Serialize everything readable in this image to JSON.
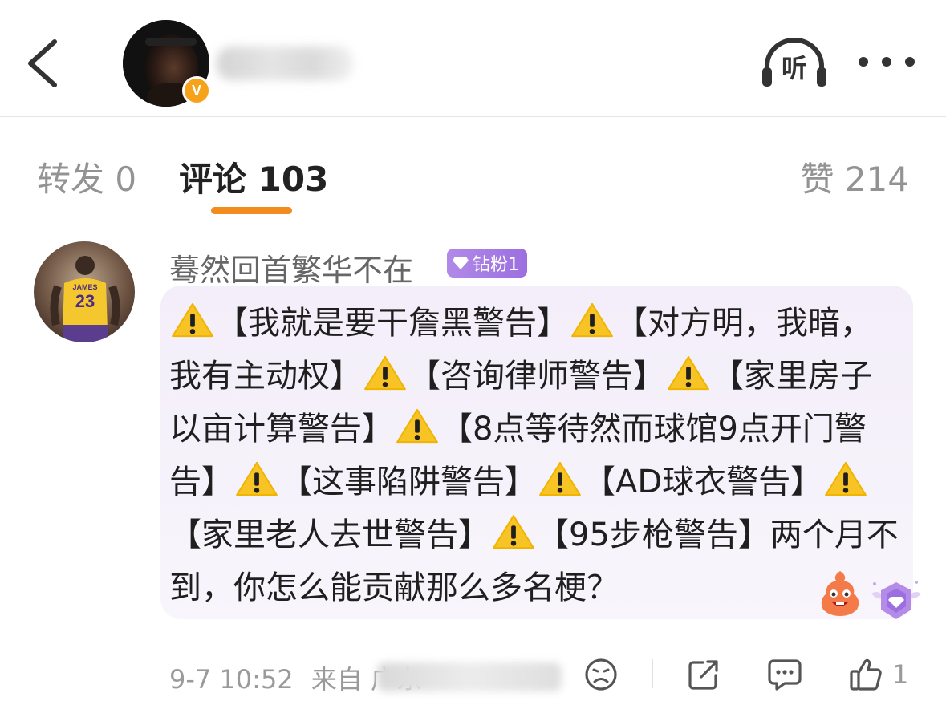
{
  "header": {
    "back_icon": "chevron-left-icon",
    "verified_badge": "V",
    "listen_label": "听",
    "more_icon": "more-dots-icon"
  },
  "tabs": {
    "repost": "转发 0",
    "comments": "评论 103",
    "likes": "赞 214",
    "active_color": "#f28c1e"
  },
  "comment": {
    "username": "蓦然回首繁华不在",
    "fan_badge": "钻粉1",
    "segments": [
      {
        "warn": true,
        "text": "【我就是要干詹黑警告】"
      },
      {
        "warn": true,
        "text": "【对方明，我暗，我有主动权】"
      },
      {
        "warn": true,
        "text": "【咨询律师警告】"
      },
      {
        "warn": true,
        "text": "【家里房子以亩计算警告】"
      },
      {
        "warn": true,
        "text": "【8点等待然而球馆9点开门警告】"
      },
      {
        "warn": true,
        "text": "【这事陷阱警告】"
      },
      {
        "warn": true,
        "text": "【AD球衣警告】"
      },
      {
        "warn": true,
        "text": "【家里老人去世警告】"
      },
      {
        "warn": true,
        "text": "【95步枪警告】"
      },
      {
        "warn": false,
        "text": "两个月不到，你怎么能贡献那么多名梗？"
      }
    ],
    "time": "9-7 10:52",
    "source": "来自 广东",
    "like_count": "1",
    "bubble_color": "#f3eef9"
  }
}
